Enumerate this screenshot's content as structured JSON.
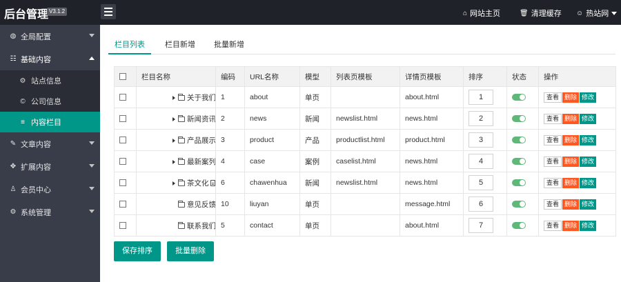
{
  "header": {
    "brand": "后台管理",
    "version": "V3.1.2",
    "links": [
      {
        "icon": "⌂",
        "label": "网站主页"
      },
      {
        "icon": "🗑",
        "label": "清理缓存"
      },
      {
        "icon": "☺",
        "label": "热站网"
      }
    ]
  },
  "sidebar": {
    "items": [
      {
        "icon": "◍",
        "label": "全局配置"
      },
      {
        "icon": "☷",
        "label": "基础内容"
      },
      {
        "icon": "✎",
        "label": "文章内容"
      },
      {
        "icon": "✥",
        "label": "扩展内容"
      },
      {
        "icon": "♙",
        "label": "会员中心"
      },
      {
        "icon": "⚙",
        "label": "系统管理"
      }
    ],
    "sub_items": [
      {
        "icon": "⚙",
        "label": "站点信息"
      },
      {
        "icon": "©",
        "label": "公司信息"
      },
      {
        "icon": "≡",
        "label": "内容栏目"
      }
    ]
  },
  "tabs": [
    "栏目列表",
    "栏目新增",
    "批量新增"
  ],
  "table": {
    "headers": [
      "栏目名称",
      "编码",
      "URL名称",
      "模型",
      "列表页模板",
      "详情页模板",
      "排序",
      "状态",
      "操作"
    ],
    "rows": [
      {
        "name": "关于我们",
        "code": "1",
        "url": "about",
        "model": "单页",
        "list_tpl": "",
        "detail_tpl": "about.html",
        "order": "1"
      },
      {
        "name": "新闻资讯",
        "code": "2",
        "url": "news",
        "model": "新闻",
        "list_tpl": "newslist.html",
        "detail_tpl": "news.html",
        "order": "2"
      },
      {
        "name": "产品展示",
        "code": "3",
        "url": "product",
        "model": "产品",
        "list_tpl": "productlist.html",
        "detail_tpl": "product.html",
        "order": "3"
      },
      {
        "name": "最新案列",
        "code": "4",
        "url": "case",
        "model": "案例",
        "list_tpl": "caselist.html",
        "detail_tpl": "news.html",
        "order": "4"
      },
      {
        "name": "茶文化",
        "code": "6",
        "url": "chawenhua",
        "model": "新闻",
        "list_tpl": "newslist.html",
        "detail_tpl": "news.html",
        "order": "5"
      },
      {
        "name": "意见反馈",
        "code": "10",
        "url": "liuyan",
        "model": "单页",
        "list_tpl": "",
        "detail_tpl": "message.html",
        "order": "6"
      },
      {
        "name": "联系我们",
        "code": "5",
        "url": "contact",
        "model": "单页",
        "list_tpl": "",
        "detail_tpl": "about.html",
        "order": "7"
      }
    ],
    "actions": {
      "view": "查看",
      "delete": "删除",
      "edit": "修改"
    }
  },
  "buttons": {
    "save_order": "保存排序",
    "batch_delete": "批量删除"
  },
  "colors": {
    "accent": "#009688",
    "danger": "#ff5722",
    "sidebar": "#393d49",
    "header": "#1f2229",
    "toggle_on": "#5fb878"
  }
}
